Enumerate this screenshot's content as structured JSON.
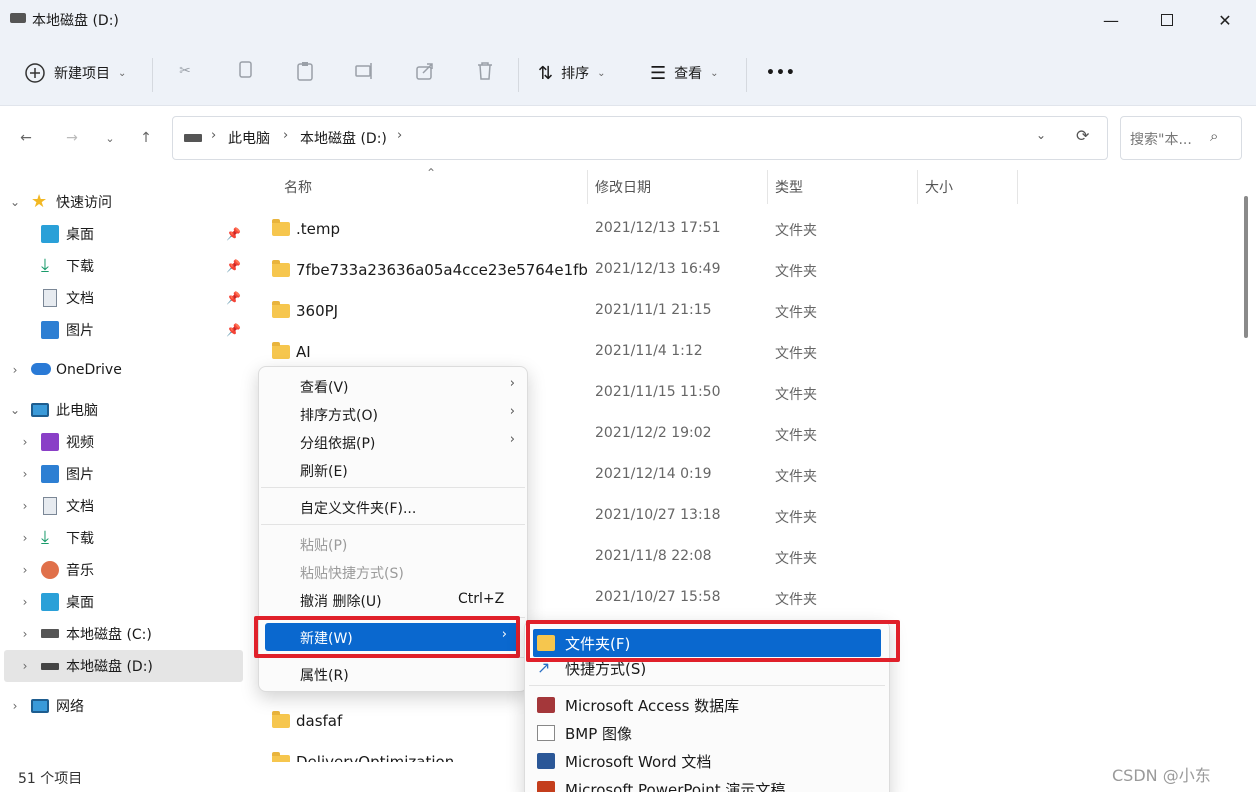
{
  "window": {
    "title": "本地磁盘 (D:)"
  },
  "toolbar": {
    "new_label": "新建项目",
    "sort_label": "排序",
    "view_label": "查看",
    "more_label": "•••"
  },
  "address": {
    "crumbs": [
      "此电脑",
      "本地磁盘 (D:)"
    ],
    "search_placeholder": "搜索\"本..."
  },
  "sidebar": {
    "quick_access": "快速访问",
    "quick_items": [
      "桌面",
      "下载",
      "文档",
      "图片"
    ],
    "onedrive": "OneDrive",
    "this_pc": "此电脑",
    "pc_items": [
      "视频",
      "图片",
      "文档",
      "下载",
      "音乐",
      "桌面",
      "本地磁盘 (C:)",
      "本地磁盘 (D:)"
    ],
    "network": "网络"
  },
  "columns": {
    "name": "名称",
    "date": "修改日期",
    "type": "类型",
    "size": "大小"
  },
  "files": [
    {
      "name": ".temp",
      "date": "2021/12/13 17:51",
      "type": "文件夹"
    },
    {
      "name": "7fbe733a23636a05a4cce23e5764e1fb",
      "date": "2021/12/13 16:49",
      "type": "文件夹"
    },
    {
      "name": "360PJ",
      "date": "2021/11/1 21:15",
      "type": "文件夹"
    },
    {
      "name": "AI",
      "date": "2021/11/4 1:12",
      "type": "文件夹"
    },
    {
      "name": "",
      "date": "2021/11/15 11:50",
      "type": "文件夹"
    },
    {
      "name": "",
      "date": "2021/12/2 19:02",
      "type": "文件夹"
    },
    {
      "name": "",
      "date": "2021/12/14 0:19",
      "type": "文件夹"
    },
    {
      "name": "",
      "date": "2021/10/27 13:18",
      "type": "文件夹"
    },
    {
      "name": "",
      "date": "2021/11/8 22:08",
      "type": "文件夹"
    },
    {
      "name": "",
      "date": "2021/10/27 15:58",
      "type": "文件夹"
    },
    {
      "name": "dasfaf",
      "date": "",
      "type": ""
    },
    {
      "name": "DeliveryOptimization",
      "date": "",
      "type": ""
    }
  ],
  "context_menu": {
    "view": "查看(V)",
    "sort": "排序方式(O)",
    "group": "分组依据(P)",
    "refresh": "刷新(E)",
    "customize": "自定义文件夹(F)...",
    "paste": "粘贴(P)",
    "paste_shortcut": "粘贴快捷方式(S)",
    "undo": "撤消 删除(U)",
    "undo_shortcut": "Ctrl+Z",
    "new": "新建(W)",
    "properties": "属性(R)"
  },
  "new_submenu": {
    "folder": "文件夹(F)",
    "shortcut": "快捷方式(S)",
    "access": "Microsoft Access 数据库",
    "bmp": "BMP 图像",
    "word": "Microsoft Word 文档",
    "ppt": "Microsoft PowerPoint 演示文稿"
  },
  "status": {
    "count": "51 个项目"
  },
  "watermark": "CSDN @小东",
  "colors": {
    "accent": "#0a68cf",
    "highlight_box": "#e0202a",
    "folder": "#f6c64e"
  }
}
